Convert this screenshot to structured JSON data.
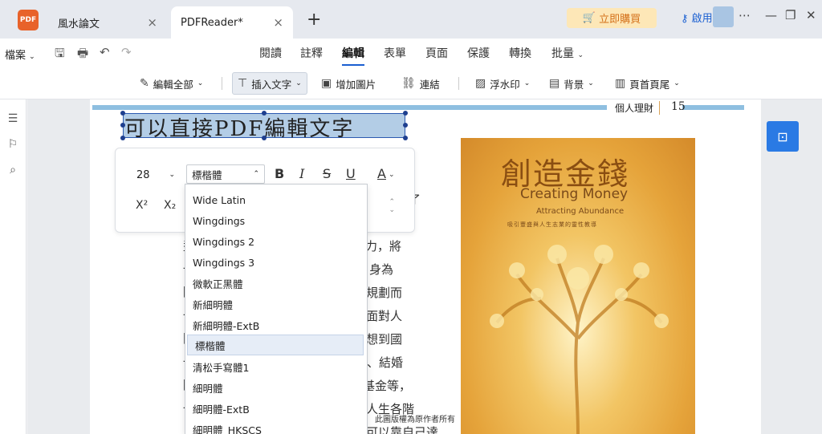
{
  "tabs": [
    {
      "label": "風水論文",
      "close": "×"
    },
    {
      "label": "PDFReader*",
      "close": "×"
    }
  ],
  "app_logo_text": "PDF",
  "new_tab_icon": "+",
  "header": {
    "buy_label": "立即購買",
    "login_label": "啟用",
    "more_icon": "⋯",
    "minimize_icon": "—",
    "maximize_icon": "❐",
    "close_icon": "✕"
  },
  "menubar": {
    "file_label": "檔案",
    "items": [
      "閱讀",
      "註釋",
      "編輯",
      "表單",
      "頁面",
      "保護",
      "轉換",
      "批量"
    ],
    "active": "編輯"
  },
  "edit_toolbar": {
    "edit_all": "編輯全部",
    "insert_text": "插入文字",
    "add_image": "增加圖片",
    "link": "連結",
    "watermark": "浮水印",
    "background": "背景",
    "header_footer": "頁首頁尾"
  },
  "document": {
    "running_header": "個人理財",
    "page_number": "15",
    "selected_text": "可以直接PDF編輯文字",
    "body_lines": [
      "力，將",
      "身為",
      "規劃而",
      "面對人",
      "想到國",
      "、結婚",
      "基金等，",
      "人生各階",
      "可以靠自己達"
    ],
    "partial_char": "了",
    "left_partials": [
      "型",
      "一",
      "圍",
      "一",
      "間",
      "一",
      "圍",
      "一"
    ],
    "cover_copyright": "此圖版權為原作者所有"
  },
  "cover": {
    "title": "創造金錢",
    "subtitle": "Creating Money",
    "tagline": "Attracting Abundance",
    "small_text": "吸引豐盛與人生志業的靈性教導"
  },
  "format_panel": {
    "font_size": "28",
    "font_family": "標楷體",
    "bold": "B",
    "italic": "I",
    "strike": "S",
    "underline": "U",
    "color": "A",
    "superscript": "X²",
    "subscript": "X₂"
  },
  "font_list": [
    "Wide Latin",
    "Wingdings",
    "Wingdings 2",
    "Wingdings 3",
    "微軟正黑體",
    "新細明體",
    "新細明體-ExtB",
    "標楷體",
    "清松手寫體1",
    "細明體",
    "細明體-ExtB",
    "細明體_HKSCS"
  ],
  "font_selected": "標楷體"
}
